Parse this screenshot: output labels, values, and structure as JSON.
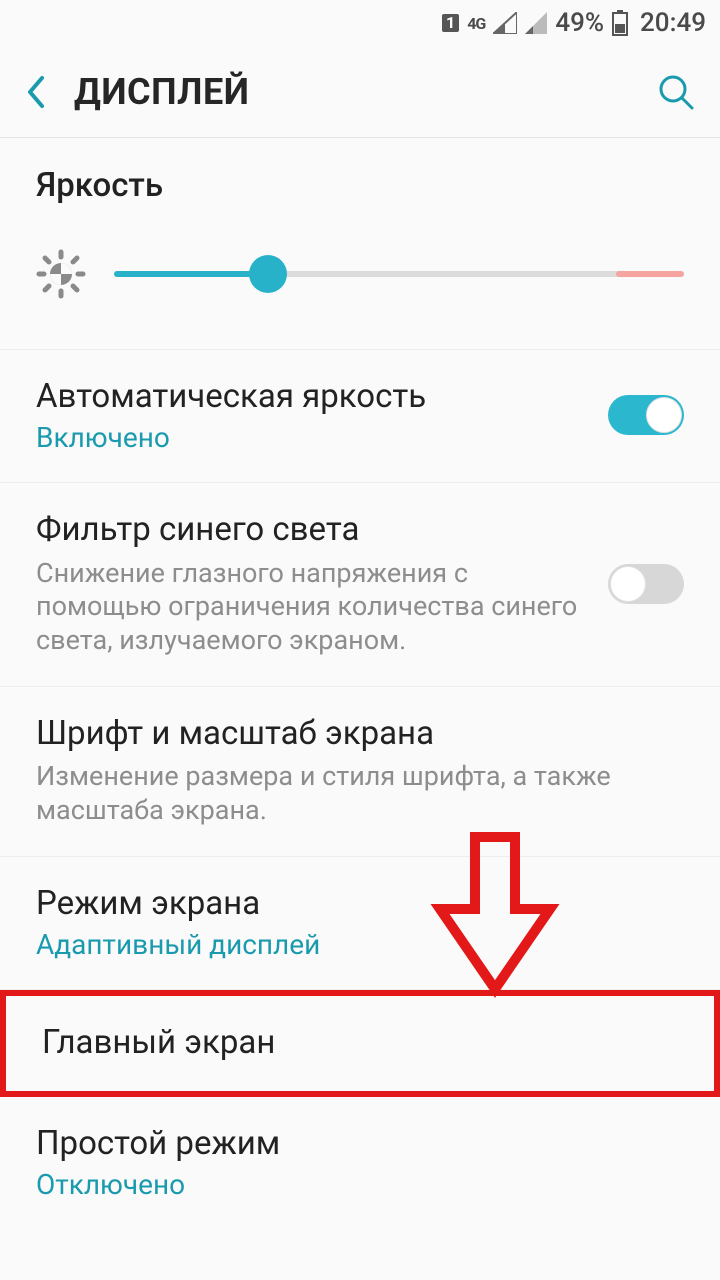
{
  "status": {
    "sim_slot": "1",
    "network": "4G",
    "battery": "49%",
    "time": "20:49"
  },
  "header": {
    "title": "ДИСПЛЕЙ"
  },
  "brightness": {
    "label": "Яркость",
    "percent": 27,
    "hot_end_percent": 12
  },
  "items": {
    "auto_brightness": {
      "title": "Автоматическая яркость",
      "status": "Включено",
      "on": true
    },
    "blue_filter": {
      "title": "Фильтр синего света",
      "desc": "Снижение глазного напряжения с помощью ограничения количества синего света, излучаемого экраном.",
      "on": false
    },
    "font_scale": {
      "title": "Шрифт и масштаб экрана",
      "desc": "Изменение размера и стиля шрифта, а также масштаба экрана."
    },
    "screen_mode": {
      "title": "Режим экрана",
      "status": "Адаптивный дисплей"
    },
    "home_screen": {
      "title": "Главный экран"
    },
    "simple_mode": {
      "title": "Простой режим",
      "status": "Отключено"
    }
  },
  "annotation": {
    "arrow_color": "#e31818"
  }
}
